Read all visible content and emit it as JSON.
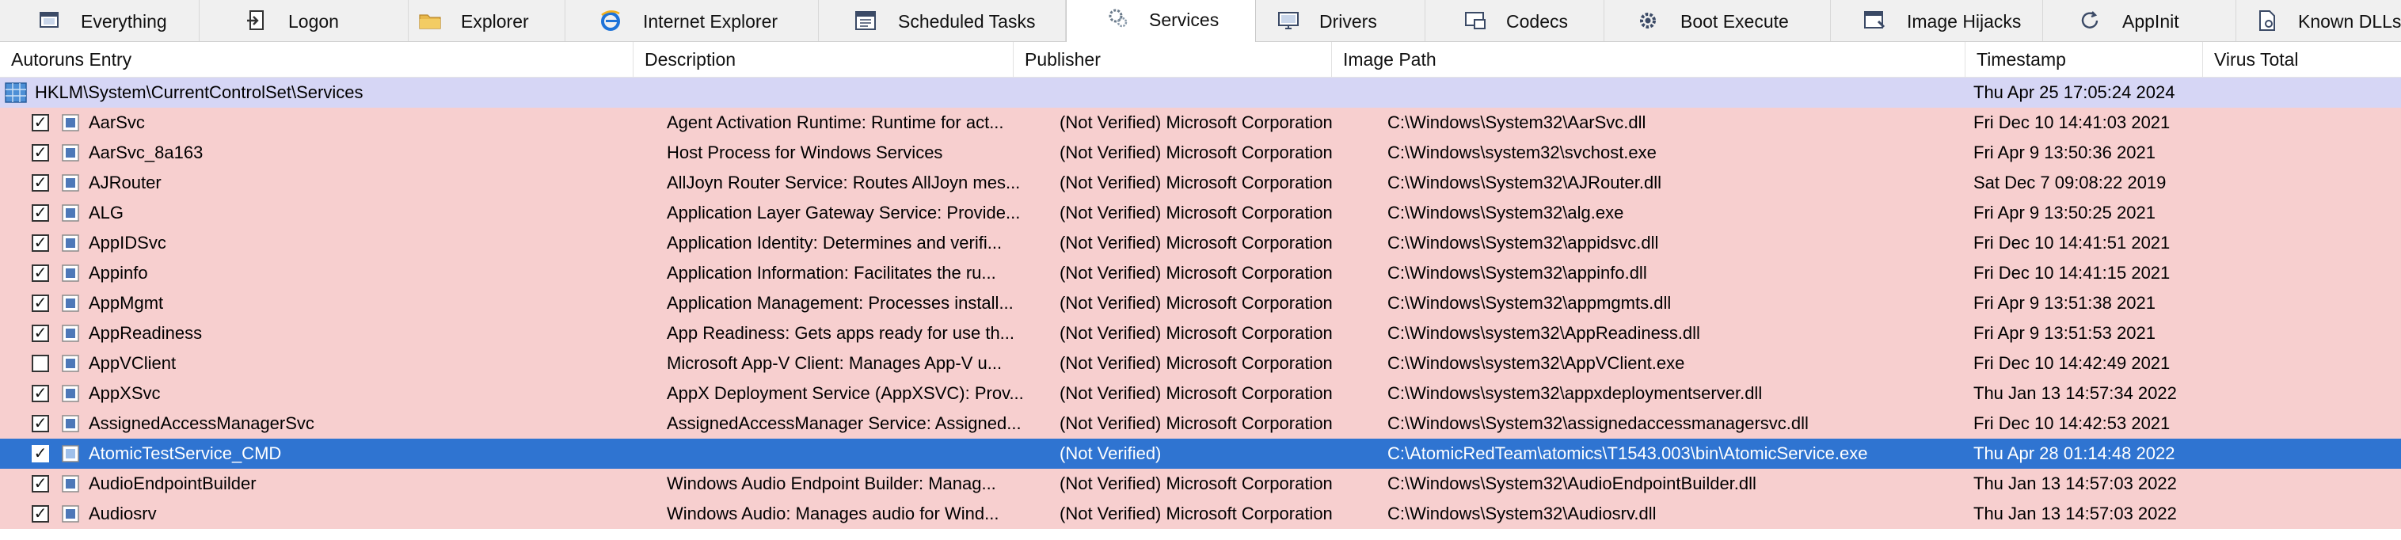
{
  "tabs": [
    {
      "label": "Everything",
      "icon": "window-icon",
      "active": false
    },
    {
      "label": "Logon",
      "icon": "logon-icon",
      "active": false
    },
    {
      "label": "Explorer",
      "icon": "folder-icon",
      "active": false
    },
    {
      "label": "Internet Explorer",
      "icon": "internet-explorer-icon",
      "active": false
    },
    {
      "label": "Scheduled Tasks",
      "icon": "calendar-icon",
      "active": false
    },
    {
      "label": "Services",
      "icon": "services-icon",
      "active": true
    },
    {
      "label": "Drivers",
      "icon": "monitor-icon",
      "active": false
    },
    {
      "label": "Codecs",
      "icon": "codec-icon",
      "active": false
    },
    {
      "label": "Boot Execute",
      "icon": "gear-icon",
      "active": false
    },
    {
      "label": "Image Hijacks",
      "icon": "image-hijack-icon",
      "active": false
    },
    {
      "label": "AppInit",
      "icon": "refresh-icon",
      "active": false
    },
    {
      "label": "Known DLLs",
      "icon": "document-icon",
      "active": false
    }
  ],
  "columns": [
    "Autoruns Entry",
    "Description",
    "Publisher",
    "Image Path",
    "Timestamp",
    "Virus Total"
  ],
  "registry_key": {
    "path": "HKLM\\System\\CurrentControlSet\\Services",
    "timestamp": "Thu Apr 25 17:05:24 2024"
  },
  "entries": [
    {
      "name": "AarSvc",
      "checked": true,
      "description": "Agent Activation Runtime: Runtime for act...",
      "publisher": "(Not Verified) Microsoft Corporation",
      "image_path": "C:\\Windows\\System32\\AarSvc.dll",
      "timestamp": "Fri Dec 10 14:41:03 2021",
      "selected": false
    },
    {
      "name": "AarSvc_8a163",
      "checked": true,
      "description": "Host Process for Windows Services",
      "publisher": "(Not Verified) Microsoft Corporation",
      "image_path": "C:\\Windows\\system32\\svchost.exe",
      "timestamp": "Fri Apr  9 13:50:36 2021",
      "selected": false
    },
    {
      "name": "AJRouter",
      "checked": true,
      "description": "AllJoyn Router Service: Routes AllJoyn mes...",
      "publisher": "(Not Verified) Microsoft Corporation",
      "image_path": "C:\\Windows\\System32\\AJRouter.dll",
      "timestamp": "Sat Dec  7 09:08:22 2019",
      "selected": false
    },
    {
      "name": "ALG",
      "checked": true,
      "description": "Application Layer Gateway Service: Provide...",
      "publisher": "(Not Verified) Microsoft Corporation",
      "image_path": "C:\\Windows\\System32\\alg.exe",
      "timestamp": "Fri Apr  9 13:50:25 2021",
      "selected": false
    },
    {
      "name": "AppIDSvc",
      "checked": true,
      "description": "Application Identity: Determines and verifi...",
      "publisher": "(Not Verified) Microsoft Corporation",
      "image_path": "C:\\Windows\\System32\\appidsvc.dll",
      "timestamp": "Fri Dec 10 14:41:51 2021",
      "selected": false
    },
    {
      "name": "Appinfo",
      "checked": true,
      "description": "Application Information: Facilitates the ru...",
      "publisher": "(Not Verified) Microsoft Corporation",
      "image_path": "C:\\Windows\\System32\\appinfo.dll",
      "timestamp": "Fri Dec 10 14:41:15 2021",
      "selected": false
    },
    {
      "name": "AppMgmt",
      "checked": true,
      "description": "Application Management: Processes install...",
      "publisher": "(Not Verified) Microsoft Corporation",
      "image_path": "C:\\Windows\\System32\\appmgmts.dll",
      "timestamp": "Fri Apr  9 13:51:38 2021",
      "selected": false
    },
    {
      "name": "AppReadiness",
      "checked": true,
      "description": "App Readiness: Gets apps ready for use th...",
      "publisher": "(Not Verified) Microsoft Corporation",
      "image_path": "C:\\Windows\\system32\\AppReadiness.dll",
      "timestamp": "Fri Apr  9 13:51:53 2021",
      "selected": false
    },
    {
      "name": "AppVClient",
      "checked": false,
      "description": "Microsoft App-V Client: Manages App-V u...",
      "publisher": "(Not Verified) Microsoft Corporation",
      "image_path": "C:\\Windows\\system32\\AppVClient.exe",
      "timestamp": "Fri Dec 10 14:42:49 2021",
      "selected": false
    },
    {
      "name": "AppXSvc",
      "checked": true,
      "description": "AppX Deployment Service (AppXSVC): Prov...",
      "publisher": "(Not Verified) Microsoft Corporation",
      "image_path": "C:\\Windows\\system32\\appxdeploymentserver.dll",
      "timestamp": "Thu Jan 13 14:57:34 2022",
      "selected": false
    },
    {
      "name": "AssignedAccessManagerSvc",
      "checked": true,
      "description": "AssignedAccessManager Service: Assigned...",
      "publisher": "(Not Verified) Microsoft Corporation",
      "image_path": "C:\\Windows\\System32\\assignedaccessmanagersvc.dll",
      "timestamp": "Fri Dec 10 14:42:53 2021",
      "selected": false
    },
    {
      "name": "AtomicTestService_CMD",
      "checked": true,
      "description": "",
      "publisher": "(Not Verified)",
      "image_path": "C:\\AtomicRedTeam\\atomics\\T1543.003\\bin\\AtomicService.exe",
      "timestamp": "Thu Apr 28 01:14:48 2022",
      "selected": true
    },
    {
      "name": "AudioEndpointBuilder",
      "checked": true,
      "description": "Windows Audio Endpoint Builder: Manag...",
      "publisher": "(Not Verified) Microsoft Corporation",
      "image_path": "C:\\Windows\\System32\\AudioEndpointBuilder.dll",
      "timestamp": "Thu Jan 13 14:57:03 2022",
      "selected": false
    },
    {
      "name": "Audiosrv",
      "checked": true,
      "description": "Windows Audio: Manages audio for Wind...",
      "publisher": "(Not Verified) Microsoft Corporation",
      "image_path": "C:\\Windows\\System32\\Audiosrv.dll",
      "timestamp": "Thu Jan 13 14:57:03 2022",
      "selected": false
    }
  ],
  "colors": {
    "row_bg": "#f7cfcf",
    "key_bg": "#d6d6f5",
    "selection": "#2f74d1"
  }
}
